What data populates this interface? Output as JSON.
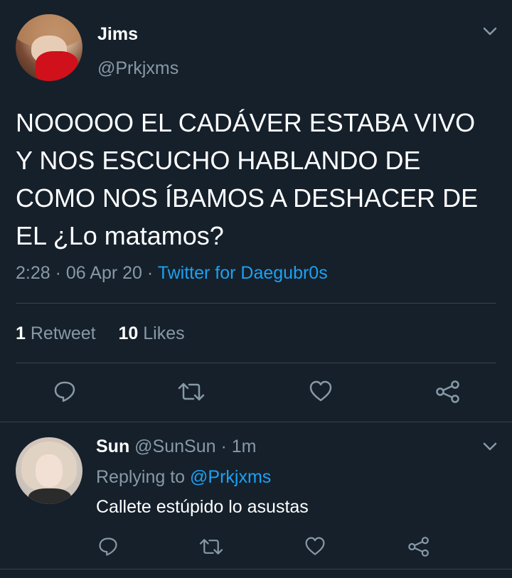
{
  "tweet": {
    "author_name": "Jims",
    "author_handle": "@Prkjxms",
    "text": "NOOOOO EL CADÁVER ESTABA VIVO Y NOS ESCUCHO HABLANDO DE COMO NOS ÍBAMOS A DESHACER DE EL ¿Lo matamos?",
    "time": "2:28",
    "sep1": "·",
    "date": "06 Apr 20",
    "sep2": "·",
    "source": "Twitter for Daegubr0s",
    "retweet_count": "1",
    "retweet_label": "Retweet",
    "like_count": "10",
    "like_label": "Likes"
  },
  "reply": {
    "author_name": "Sun",
    "author_handle": "@SunSun",
    "sep": "·",
    "time": "1m",
    "replying_prefix": "Replying to",
    "replying_handle": "@Prkjxms",
    "text": "Callete estúpido lo asustas"
  },
  "icons": {
    "reply": "speech-bubble-icon",
    "retweet": "retweet-icon",
    "like": "heart-icon",
    "share": "share-icon",
    "menu": "chevron-down-icon"
  },
  "colors": {
    "background": "#15202b",
    "text": "#ffffff",
    "secondary": "#8899a6",
    "accent": "#1da1f2",
    "divider": "#38444d"
  }
}
